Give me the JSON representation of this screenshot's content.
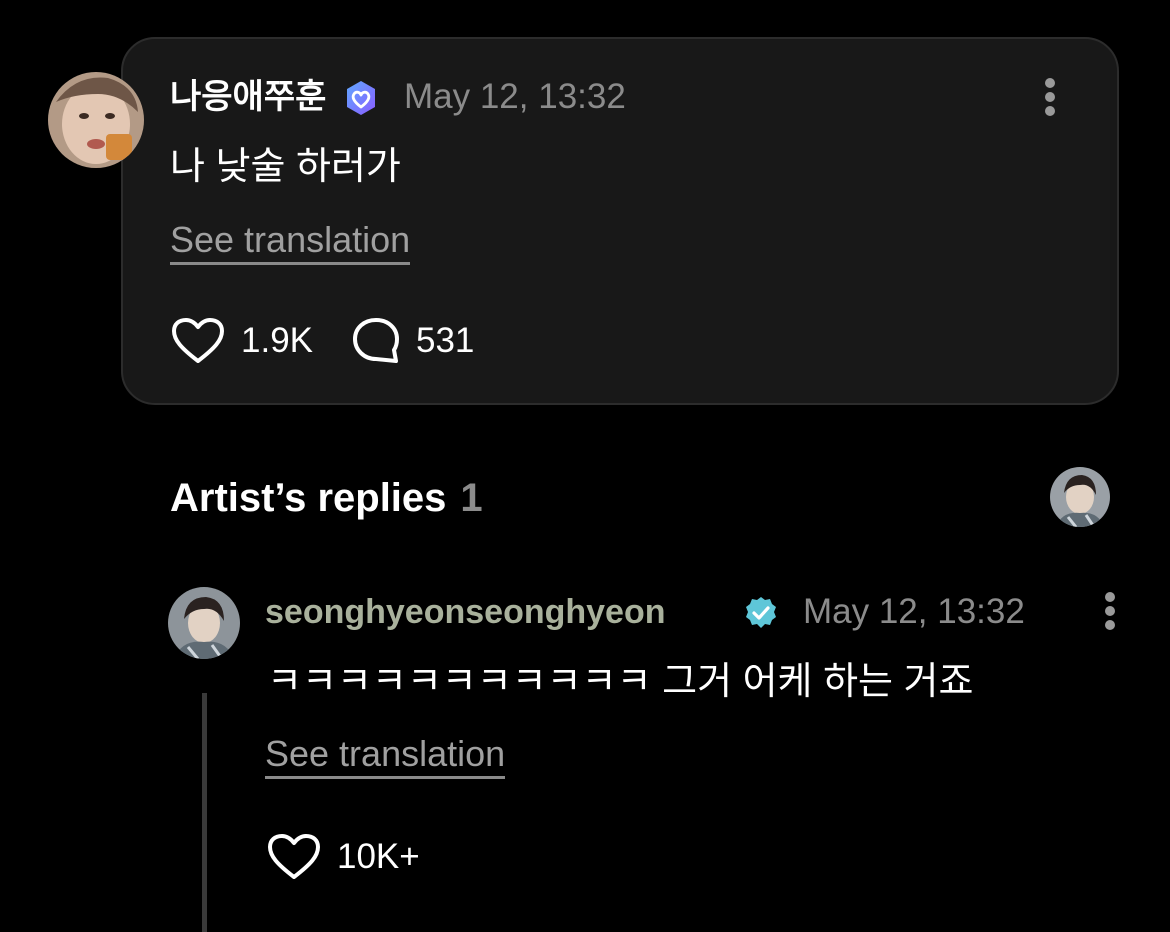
{
  "post": {
    "author": "나응애쭈훈",
    "timestamp": "May 12, 13:32",
    "text": "나 낮술 하러가",
    "see_translation": "See translation",
    "likes": "1.9K",
    "comments": "531",
    "icons": {
      "avatar": "user-avatar",
      "badge": "verified-heart-badge-icon",
      "more": "more-vertical-icon",
      "like": "heart-outline-icon",
      "comment": "speech-bubble-icon"
    }
  },
  "artist_replies": {
    "title": "Artist’s replies",
    "count": "1",
    "icons": {
      "avatar": "artist-avatar"
    }
  },
  "reply": {
    "author": "seonghyeonseonghyeon",
    "timestamp": "May 12, 13:32",
    "text": "ㅋㅋㅋㅋㅋㅋㅋㅋㅋㅋㅋ 그거 어케 하는 거죠",
    "see_translation": "See translation",
    "likes": "10K+",
    "icons": {
      "badge": "verified-check-badge-icon",
      "more": "more-vertical-icon",
      "like": "heart-outline-icon"
    }
  },
  "colors": {
    "background": "#000000",
    "card": "#181818",
    "card_border": "#2c2c2c",
    "muted_text": "#8b8b8b",
    "post_badge": "#6b7cff",
    "reply_badge": "#5ec6d8",
    "reply_name": "#a9b19c"
  }
}
